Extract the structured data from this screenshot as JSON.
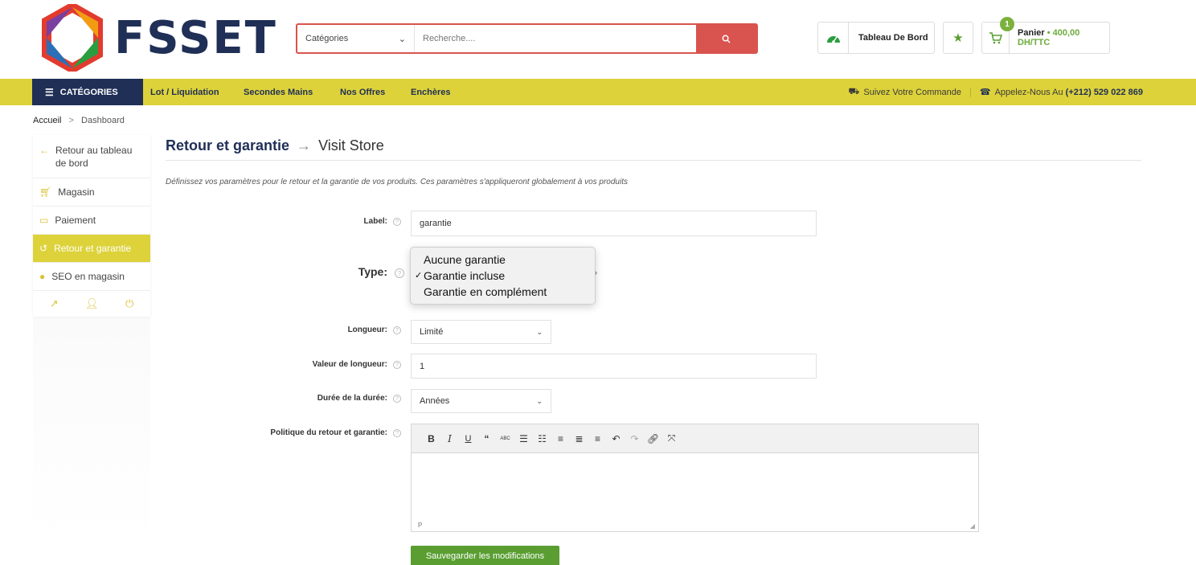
{
  "header": {
    "logo_text": "FSSET",
    "search": {
      "category_label": "Catégories",
      "placeholder": "Recherche...."
    },
    "dashboard_label": "Tableau De Bord",
    "cart": {
      "badge": "1",
      "label": "Panier",
      "separator": "•",
      "amount": "400,00 DH/TTC"
    }
  },
  "nav": {
    "categories_label": "CATÉGORIES",
    "links": [
      "Lot / Liquidation",
      "Secondes Mains",
      "Nos Offres",
      "Enchères"
    ],
    "track_order": "Suivez Votre Commande",
    "separator": "|",
    "call_label": "Appelez-Nous Au",
    "phone": "(+212) 529 022 869"
  },
  "breadcrumb": {
    "home": "Accueil",
    "separator": ">",
    "current": "Dashboard"
  },
  "sidebar": {
    "items": [
      {
        "label": "Retour au tableau de bord",
        "icon": "back-arrow-icon"
      },
      {
        "label": "Magasin",
        "icon": "cart-icon"
      },
      {
        "label": "Paiement",
        "icon": "credit-card-icon"
      },
      {
        "label": "Retour et garantie",
        "icon": "undo-icon",
        "active": true
      },
      {
        "label": "SEO en magasin",
        "icon": "globe-icon"
      }
    ]
  },
  "page": {
    "title": "Retour et garantie",
    "arrow": "→",
    "subtitle": "Visit Store",
    "description": "Définissez vos paramètres pour le retour et la garantie de vos produits. Ces paramètres s'appliqueront globalement à vos produits"
  },
  "form": {
    "label_field": {
      "label": "Label:",
      "value": "garantie"
    },
    "type_field": {
      "label": "Type:",
      "options": [
        "Aucune garantie",
        "Garantie incluse",
        "Garantie en complément"
      ],
      "selected": "Garantie incluse"
    },
    "length_field": {
      "label": "Longueur:",
      "value": "Limité"
    },
    "length_value_field": {
      "label": "Valeur de longueur:",
      "value": "1"
    },
    "duration_field": {
      "label": "Durée de la durée:",
      "value": "Années"
    },
    "policy_field": {
      "label": "Politique du retour et garantie:",
      "status": "P"
    },
    "save_label": "Sauvegarder les modifications"
  },
  "colors": {
    "navy": "#1f2f56",
    "yellow": "#ddd23a",
    "red": "#d9534f",
    "green": "#5a9e32"
  }
}
